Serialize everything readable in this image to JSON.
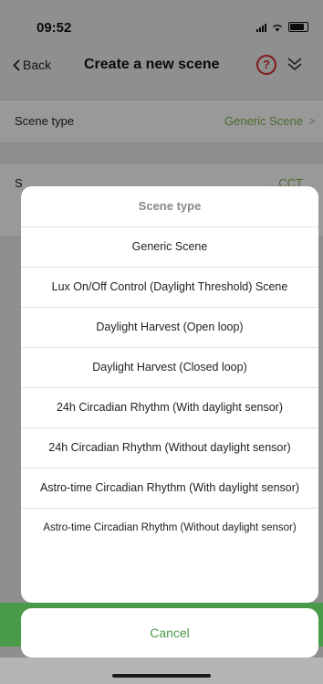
{
  "status_bar": {
    "time": "09:52"
  },
  "nav": {
    "back_label": "Back",
    "title": "Create a new scene",
    "help_symbol": "?"
  },
  "settings": {
    "scene_type_label": "Scene type",
    "scene_type_value": "Generic Scene",
    "second_row_label": "S",
    "second_row_value": "...CCT"
  },
  "sheet": {
    "title": "Scene type",
    "options": [
      "Generic Scene",
      "Lux On/Off Control (Daylight Threshold) Scene",
      "Daylight Harvest (Open loop)",
      "Daylight Harvest (Closed loop)",
      "24h Circadian Rhythm (With daylight sensor)",
      "24h Circadian Rhythm (Without daylight sensor)",
      "Astro-time Circadian Rhythm (With daylight sensor)",
      "Astro-time Circadian Rhythm (Without daylight sensor)"
    ],
    "cancel_label": "Cancel"
  },
  "colors": {
    "accent_green": "#4a9b49",
    "value_green": "#7db34f",
    "help_red": "#d4282c"
  },
  "icons": [
    "chevron-left-icon",
    "help-icon",
    "double-chevron-down-icon",
    "chevron-right-icon"
  ]
}
